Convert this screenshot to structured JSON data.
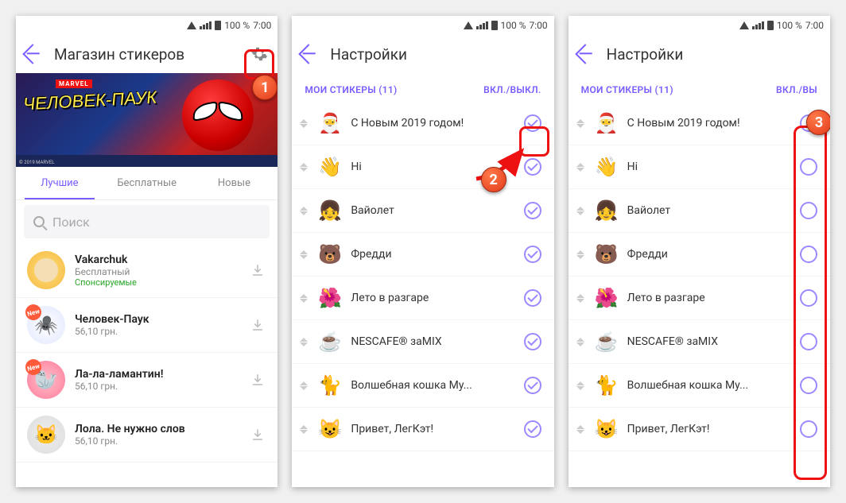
{
  "status": {
    "battery": "100 %",
    "time": "7:00"
  },
  "screen1": {
    "title": "Магазин стикеров",
    "banner": {
      "brand": "MARVEL",
      "title": "ЧЕЛОВЕК-ПАУК",
      "copyright": "© 2019 MARVEL"
    },
    "tabs": [
      "Лучшие",
      "Бесплатные",
      "Новые"
    ],
    "search_placeholder": "Поиск",
    "items": [
      {
        "name": "Vakarchuk",
        "price": "Бесплатный",
        "sponsor": "Спонсируемые"
      },
      {
        "name": "Человек-Паук",
        "price": "56,10 грн."
      },
      {
        "name": "Ла-ла-ламантин!",
        "price": "56,10 грн."
      },
      {
        "name": "Лола. Не нужно слов",
        "price": "56,10 грн."
      }
    ]
  },
  "screen2": {
    "title": "Настройки",
    "header_left": "МОИ СТИКЕРЫ (11)",
    "header_right": "ВКЛ./ВЫКЛ.",
    "items": [
      {
        "name": "С Новым 2019 годом!",
        "emoji": "🎅"
      },
      {
        "name": "Hi",
        "emoji": "👋"
      },
      {
        "name": "Вайолет",
        "emoji": "👧"
      },
      {
        "name": "Фредди",
        "emoji": "🐻"
      },
      {
        "name": "Лето в разгаре",
        "emoji": "🌺"
      },
      {
        "name": "NESCAFE® заMIX",
        "emoji": "☕"
      },
      {
        "name": "Волшебная кошка Му...",
        "emoji": "🐈"
      },
      {
        "name": "Привет, ЛегКэт!",
        "emoji": "😺"
      }
    ]
  },
  "screen3": {
    "title": "Настройки",
    "header_left": "МОИ СТИКЕРЫ (11)",
    "header_right": "ВКЛ./ВЫ",
    "items": [
      {
        "name": "С Новым 2019 годом!",
        "emoji": "🎅"
      },
      {
        "name": "Hi",
        "emoji": "👋"
      },
      {
        "name": "Вайолет",
        "emoji": "👧"
      },
      {
        "name": "Фредди",
        "emoji": "🐻"
      },
      {
        "name": "Лето в разгаре",
        "emoji": "🌺"
      },
      {
        "name": "NESCAFE® заMIX",
        "emoji": "☕"
      },
      {
        "name": "Волшебная кошка Му...",
        "emoji": "🐈"
      },
      {
        "name": "Привет, ЛегКэт!",
        "emoji": "😺"
      }
    ]
  },
  "callouts": {
    "c1": "1",
    "c2": "2",
    "c3": "3"
  }
}
